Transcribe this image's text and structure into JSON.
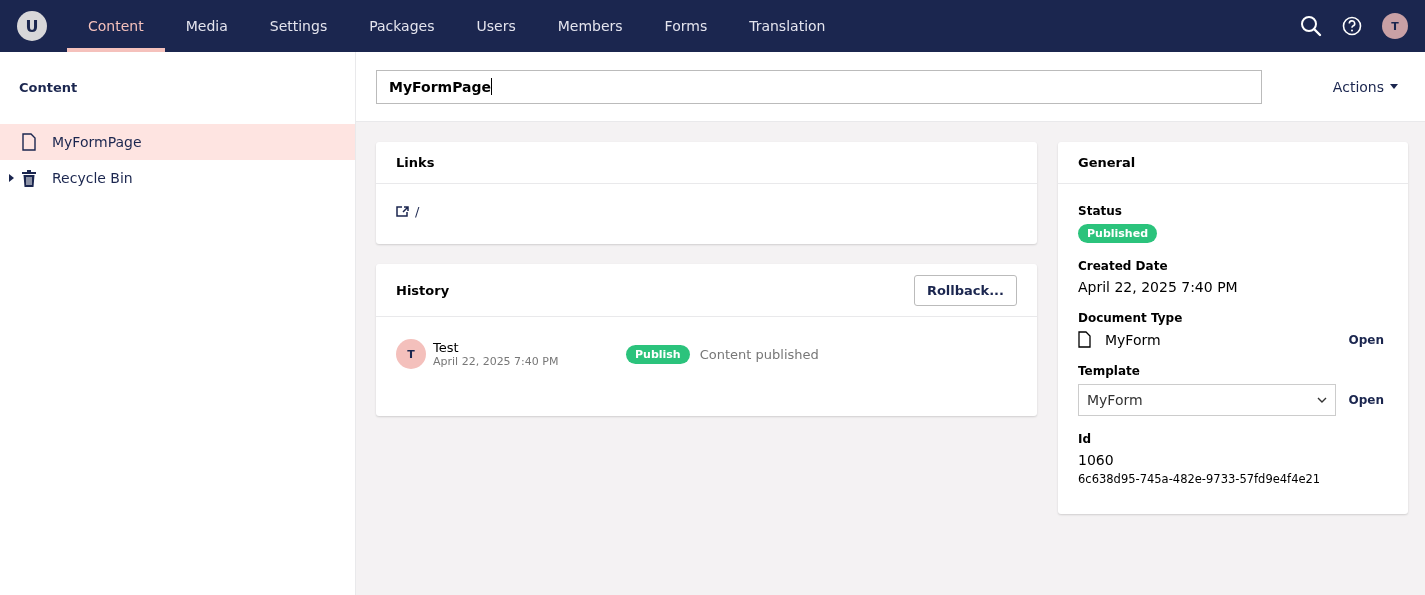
{
  "logo": {
    "letter": "U"
  },
  "nav": [
    {
      "label": "Content",
      "selected": true
    },
    {
      "label": "Media",
      "selected": false
    },
    {
      "label": "Settings",
      "selected": false
    },
    {
      "label": "Packages",
      "selected": false
    },
    {
      "label": "Users",
      "selected": false
    },
    {
      "label": "Members",
      "selected": false
    },
    {
      "label": "Forms",
      "selected": false
    },
    {
      "label": "Translation",
      "selected": false
    }
  ],
  "user_avatar": "T",
  "sidebar": {
    "title": "Content",
    "items": [
      {
        "label": "MyFormPage",
        "kind": "document",
        "selected": true,
        "has_children": false
      },
      {
        "label": "Recycle Bin",
        "kind": "trash",
        "selected": false,
        "has_children": true
      }
    ]
  },
  "editor": {
    "name": "MyFormPage",
    "actions": "Actions"
  },
  "links": {
    "title": "Links",
    "url": "/"
  },
  "history": {
    "title": "History",
    "rollback": "Rollback...",
    "entries": [
      {
        "avatar": "T",
        "user": "Test",
        "date": "April 22, 2025 7:40 PM",
        "badge": "Publish",
        "message": "Content published"
      }
    ]
  },
  "general": {
    "title": "General",
    "status_label": "Status",
    "status": "Published",
    "created_label": "Created Date",
    "created": "April 22, 2025 7:40 PM",
    "doctype_label": "Document Type",
    "doctype": "MyForm",
    "doctype_open": "Open",
    "template_label": "Template",
    "template": "MyForm",
    "template_open": "Open",
    "id_label": "Id",
    "id": "1060",
    "guid": "6c638d95-745a-482e-9733-57fd9e4f4e21"
  }
}
